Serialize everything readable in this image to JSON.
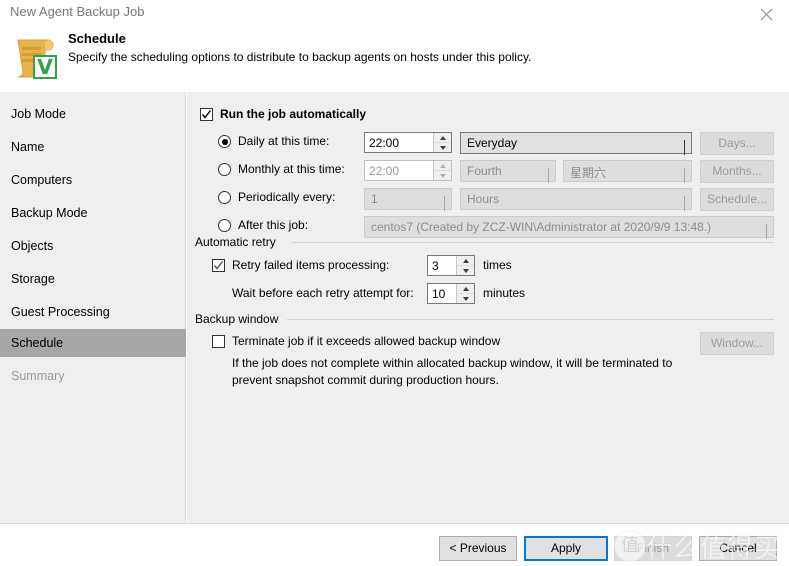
{
  "window": {
    "title": "New Agent Backup Job",
    "close_icon": "close-icon"
  },
  "header": {
    "icon": "schedule-document-icon",
    "badge": "V",
    "title": "Schedule",
    "subtitle": "Specify the scheduling options to distribute to backup agents on hosts under this policy."
  },
  "sidebar": {
    "items": [
      {
        "label": "Job Mode",
        "state": "normal"
      },
      {
        "label": "Name",
        "state": "normal"
      },
      {
        "label": "Computers",
        "state": "normal"
      },
      {
        "label": "Backup Mode",
        "state": "normal"
      },
      {
        "label": "Objects",
        "state": "normal"
      },
      {
        "label": "Storage",
        "state": "normal"
      },
      {
        "label": "Guest Processing",
        "state": "normal"
      },
      {
        "label": "Schedule",
        "state": "selected"
      },
      {
        "label": "Summary",
        "state": "disabled"
      }
    ]
  },
  "main": {
    "run_automatically": {
      "label": "Run the job automatically",
      "checked": true
    },
    "schedule_modes": {
      "selected": "daily",
      "daily": {
        "label": "Daily at this time:",
        "time": "22:00",
        "recurrence": "Everyday",
        "button": "Days..."
      },
      "monthly": {
        "label": "Monthly at this time:",
        "time": "22:00",
        "week_ordinal": "Fourth",
        "weekday": "星期六",
        "button": "Months..."
      },
      "periodically": {
        "label": "Periodically every:",
        "interval": "1",
        "unit": "Hours",
        "button": "Schedule..."
      },
      "after_job": {
        "label": "After this job:",
        "value": "centos7 (Created by ZCZ-WIN\\Administrator at 2020/9/9 13:48.)"
      }
    },
    "automatic_retry": {
      "group_title": "Automatic retry",
      "retry_checkbox_label": "Retry failed items processing:",
      "retry_checked": true,
      "retry_times": "3",
      "retry_times_unit": "times",
      "wait_label": "Wait before each retry attempt for:",
      "wait_minutes": "10",
      "wait_unit": "minutes"
    },
    "backup_window": {
      "group_title": "Backup window",
      "terminate_label": "Terminate job if it exceeds allowed backup window",
      "terminate_checked": false,
      "window_button": "Window...",
      "description_line1": "If the job does not complete within allocated backup window, it will be terminated to",
      "description_line2": "prevent snapshot commit during production hours."
    }
  },
  "footer": {
    "previous": "< Previous",
    "apply": "Apply",
    "finish": "Finish",
    "cancel": "Cancel"
  },
  "watermark": {
    "badge": "值",
    "text": "什么值得买"
  }
}
